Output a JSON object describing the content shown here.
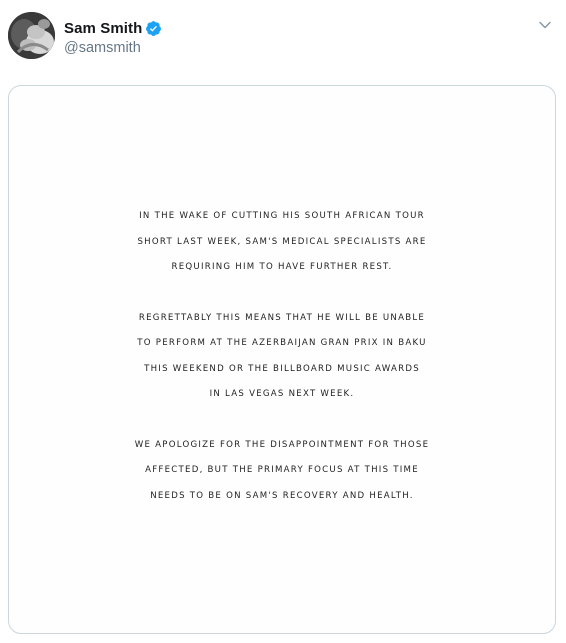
{
  "tweet": {
    "author": {
      "display_name": "Sam Smith",
      "handle": "@samsmith",
      "verified": true,
      "avatar_icon": "avatar-photo",
      "verified_icon": "verified-badge-icon"
    },
    "menu_icon": "chevron-down-icon",
    "media": {
      "paragraphs": [
        [
          "IN THE WAKE OF CUTTING HIS SOUTH AFRICAN TOUR",
          "SHORT LAST WEEK, SAM'S MEDICAL SPECIALISTS ARE",
          "REQUIRING HIM TO HAVE FURTHER REST."
        ],
        [
          "REGRETTABLY THIS MEANS THAT HE WILL BE UNABLE",
          "TO PERFORM AT THE AZERBAIJAN GRAN PRIX IN BAKU",
          "THIS WEEKEND OR THE BILLBOARD MUSIC AWARDS",
          "IN LAS VEGAS NEXT WEEK."
        ],
        [
          "WE APOLOGIZE FOR THE DISAPPOINTMENT FOR THOSE",
          "AFFECTED, BUT THE PRIMARY FOCUS AT THIS TIME",
          "NEEDS TO BE ON SAM'S RECOVERY AND HEALTH."
        ]
      ]
    }
  },
  "colors": {
    "name": "#14171a",
    "handle": "#657786",
    "verified": "#1da1f2",
    "card_border": "#ccd6dd",
    "statement_text": "#1f1f1f"
  }
}
